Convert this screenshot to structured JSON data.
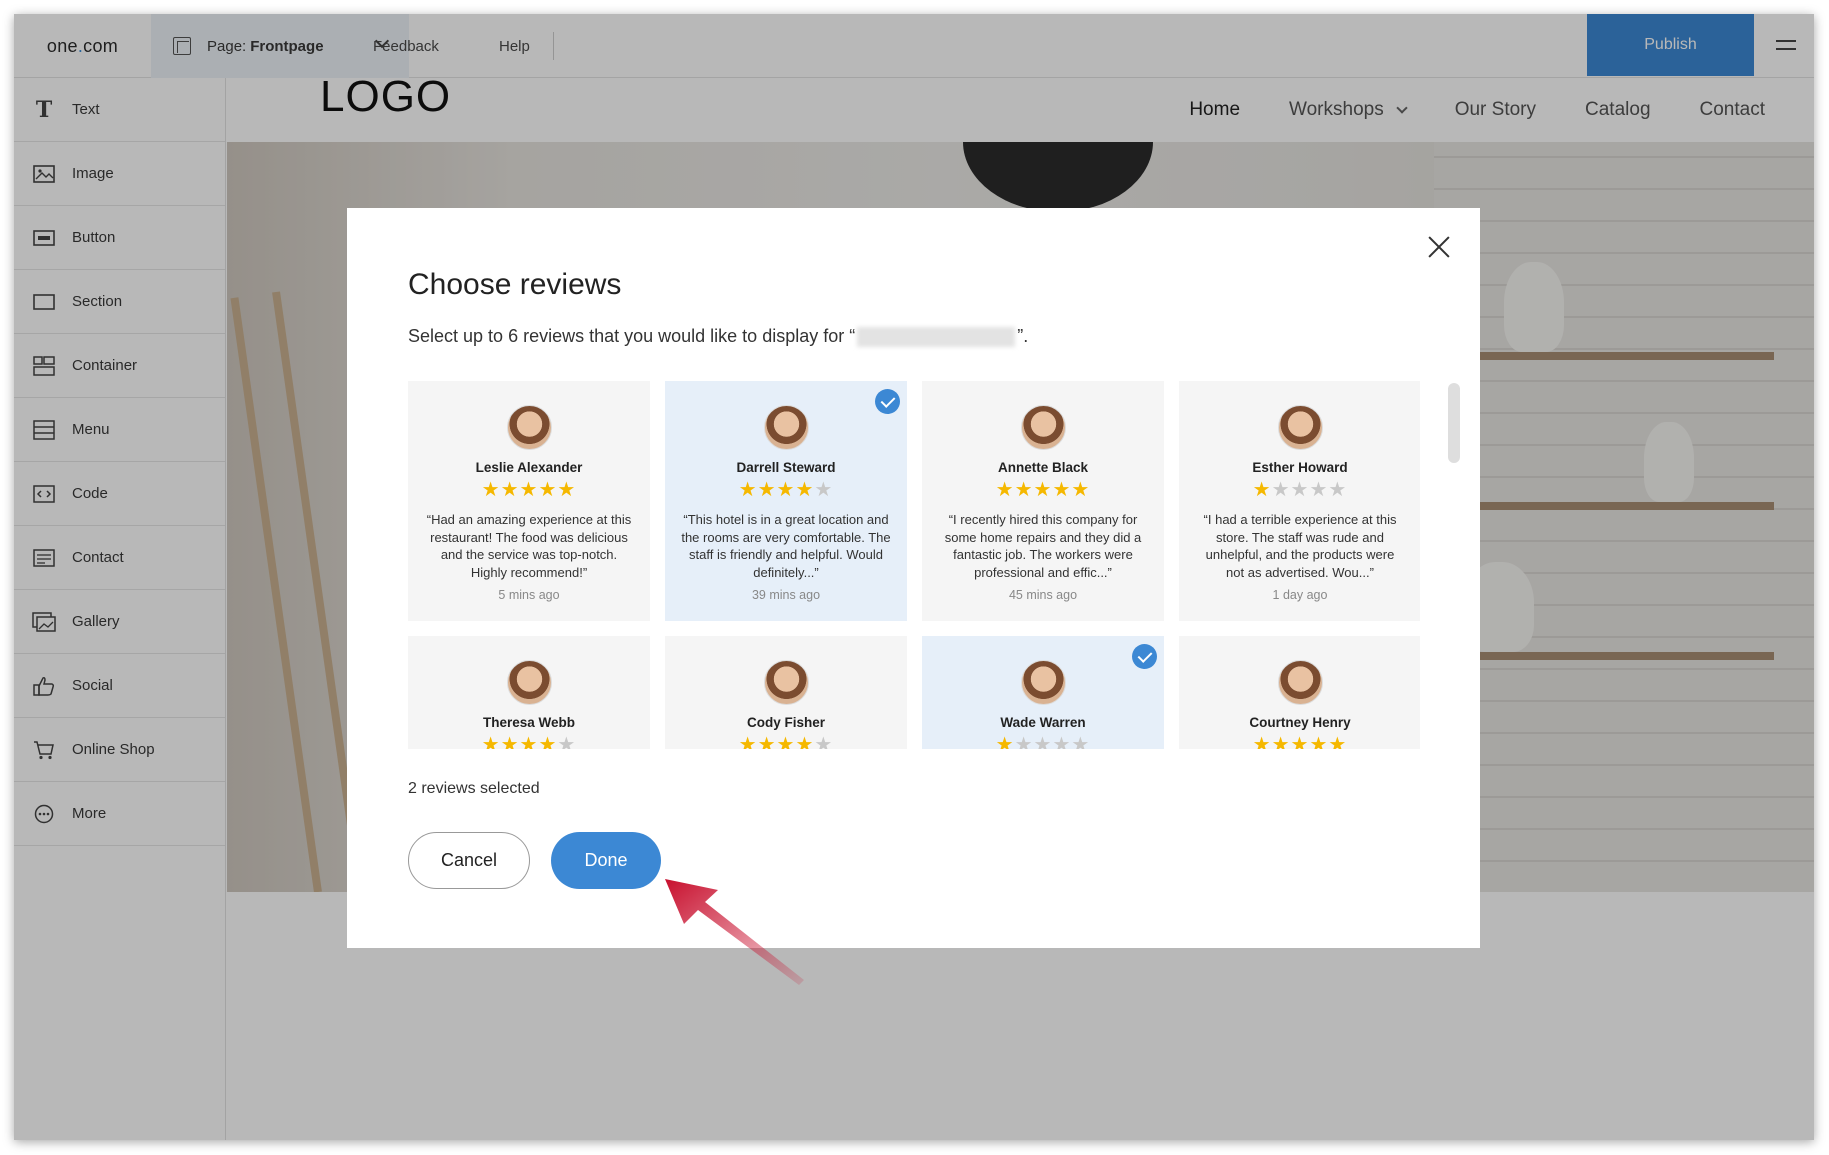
{
  "topbar": {
    "brand_prefix": "one",
    "brand_dot": ".",
    "brand_suffix": "com",
    "page_prefix": "Page:",
    "page_name": "Frontpage",
    "feedback": "Feedback",
    "help": "Help",
    "publish": "Publish"
  },
  "sidebar": {
    "items": [
      {
        "label": "Text",
        "icon": "text-icon"
      },
      {
        "label": "Image",
        "icon": "image-icon"
      },
      {
        "label": "Button",
        "icon": "button-icon"
      },
      {
        "label": "Section",
        "icon": "section-icon"
      },
      {
        "label": "Container",
        "icon": "container-icon"
      },
      {
        "label": "Menu",
        "icon": "menu-icon"
      },
      {
        "label": "Code",
        "icon": "code-icon"
      },
      {
        "label": "Contact",
        "icon": "contact-icon"
      },
      {
        "label": "Gallery",
        "icon": "gallery-icon"
      },
      {
        "label": "Social",
        "icon": "thumbs-up-icon"
      },
      {
        "label": "Online Shop",
        "icon": "cart-icon"
      },
      {
        "label": "More",
        "icon": "more-icon"
      }
    ]
  },
  "site": {
    "logo": "LOGO",
    "nav": [
      "Home",
      "Workshops",
      "Our Story",
      "Catalog",
      "Contact"
    ]
  },
  "modal": {
    "title": "Choose reviews",
    "subtitle_before": "Select up to 6 reviews that you would like to display for “",
    "subtitle_after": "”.",
    "selected_count": "2 reviews selected",
    "cancel": "Cancel",
    "done": "Done",
    "reviews": [
      {
        "name": "Leslie Alexander",
        "rating": 5,
        "text": "“Had an amazing experience at this restaurant! The food was delicious and the service was top-notch. Highly recommend!”",
        "time": "5 mins ago",
        "selected": false
      },
      {
        "name": "Darrell Steward",
        "rating": 4,
        "text": "“This hotel is in a great location and the rooms are very comfortable. The staff is friendly and helpful. Would definitely...”",
        "time": "39 mins ago",
        "selected": true
      },
      {
        "name": "Annette Black",
        "rating": 5,
        "text": "“I recently hired this company for some home repairs and they did a fantastic job. The workers were professional and effic...”",
        "time": "45 mins ago",
        "selected": false
      },
      {
        "name": "Esther Howard",
        "rating": 1,
        "text": "“I had a terrible experience at this store. The staff was rude and unhelpful, and the products were not as advertised. Wou...”",
        "time": "1 day ago",
        "selected": false
      },
      {
        "name": "Theresa Webb",
        "rating": 4,
        "text": "",
        "time": "",
        "selected": false
      },
      {
        "name": "Cody Fisher",
        "rating": 4,
        "text": "",
        "time": "",
        "selected": false
      },
      {
        "name": "Wade Warren",
        "rating": 1,
        "text": "",
        "time": "",
        "selected": true
      },
      {
        "name": "Courtney Henry",
        "rating": 5,
        "text": "",
        "time": "",
        "selected": false
      }
    ]
  },
  "colors": {
    "accent": "#3c88d4",
    "star": "#f5b800",
    "selected_card": "#e6eff9",
    "arrow": "#c8102e"
  }
}
